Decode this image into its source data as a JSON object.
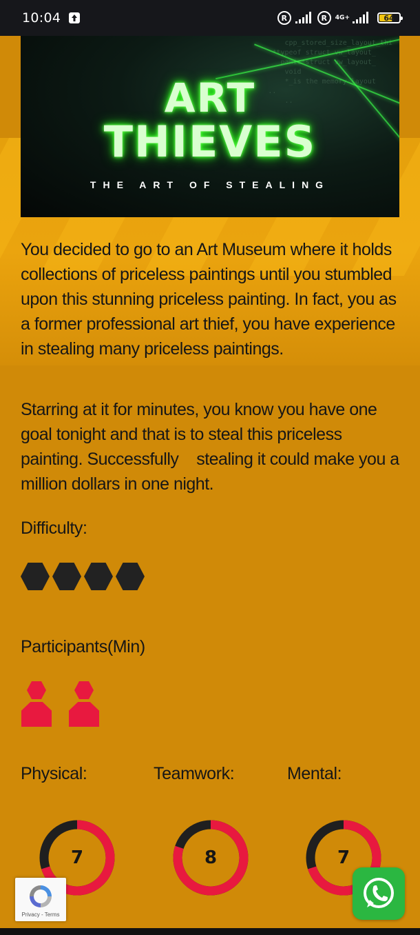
{
  "status": {
    "time": "10:04",
    "network_label": "4G+",
    "battery": "64",
    "battery_level": 0.64
  },
  "banner": {
    "title_line1": "ART",
    "title_line2": "THIEVES",
    "subtitle": "THE ART OF STEALING"
  },
  "description": [
    "You decided to go to an Art Museum where it holds collections of priceless paintings until you stumbled upon this stunning priceless painting. In fact, you as a former professional art thief, you have experience in stealing many priceless paintings.",
    "Starring at it for minutes, you know you have one goal tonight and that is to steal this priceless painting. Successfully    stealing it could make you a million dollars in one night."
  ],
  "difficulty": {
    "label": "Difficulty:",
    "level": 4
  },
  "participants": {
    "label": "Participants(Min)",
    "count": 2
  },
  "stats": [
    {
      "label": "Physical:",
      "value": "7",
      "fraction": 0.7
    },
    {
      "label": "Teamwork:",
      "value": "8",
      "fraction": 0.8
    },
    {
      "label": "Mental:",
      "value": "7",
      "fraction": 0.7
    }
  ],
  "recaptcha": {
    "text": "Privacy - Terms"
  },
  "colors": {
    "background": "#d08a08",
    "accent_red": "#e8193f",
    "dark": "#1f1f1f",
    "neon_green": "#2dff1e",
    "whatsapp_green": "#2bb741"
  },
  "icons": [
    "upload-icon",
    "registered-icon",
    "signal-icon",
    "battery-icon",
    "recaptcha-icon",
    "whatsapp-icon"
  ]
}
